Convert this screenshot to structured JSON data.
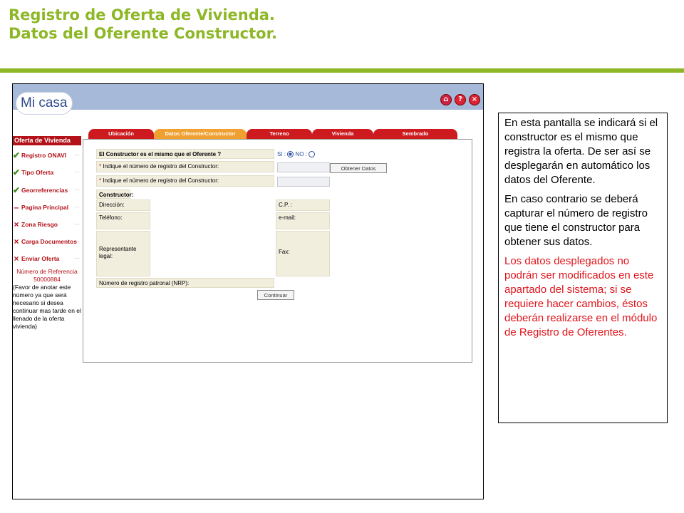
{
  "slide": {
    "title_line1": "Registro de Oferta de Vivienda.",
    "title_line2": "Datos del Oferente Constructor."
  },
  "app": {
    "logo": "Mi casa",
    "window_icons": [
      "home-icon",
      "help-icon",
      "close-icon"
    ]
  },
  "sidebar": {
    "title": "Oferta de Vivienda",
    "items": [
      {
        "label": "Registro ONAVI",
        "status": "✔",
        "icon": "check-icon"
      },
      {
        "label": "Tipo Oferta",
        "status": "✔",
        "icon": "check-icon"
      },
      {
        "label": "Georreferencias",
        "status": "✔",
        "icon": "check-icon"
      },
      {
        "label": "Pagina Principal",
        "status": "–",
        "icon": "dash-icon"
      },
      {
        "label": "Zona Riesgo",
        "status": "×",
        "icon": "x-icon"
      },
      {
        "label": "Carga Documentos",
        "status": "×",
        "icon": "x-icon"
      },
      {
        "label": "Enviar Oferta",
        "status": "×",
        "icon": "x-icon"
      }
    ],
    "ref_title": "Número de Referencia",
    "ref_number": "50000884",
    "ref_note": "(Favor de anotar este número ya que será necesario si desea continuar mas tarde en el llenado de la oferta vivienda)"
  },
  "tabs": [
    {
      "label": "Ubicación"
    },
    {
      "label": "Datos Oferente/Constructor"
    },
    {
      "label": "Terreno"
    },
    {
      "label": "Vivienda"
    },
    {
      "label": "Sembrado"
    }
  ],
  "form": {
    "question": "El Constructor es el mismo que el Oferente ?",
    "si_label": "SI :",
    "no_label": "NO :",
    "selected": "SI",
    "field1_label": "Indique el número de registro del Constructor:",
    "field2_label": "Indique el número de registro del Constructor:",
    "obtain_button": "Obtener Datos",
    "section_title": "Constructor:",
    "direccion": "Dirección:",
    "telefono": "Teléfono:",
    "representante": "Representante legal:",
    "cp": "C.P. :",
    "email": "e-mail:",
    "fax": "Fax:",
    "nrp": "Número de registro patronal (NRP):",
    "continue_button": "Continuar"
  },
  "note": {
    "p1": "En esta pantalla se indicará si el constructor es el mismo que registra la oferta. De ser así se desplegarán en automático los datos del Oferente.",
    "p2": "En caso contrario se deberá capturar el número de registro que tiene el constructor para obtener sus datos.",
    "p3": "Los datos desplegados no podrán ser modificados en este apartado del sistema; si se requiere hacer cambios, éstos deberán realizarse en el módulo de Registro de Oferentes."
  },
  "colors": {
    "title_green": "#8db726",
    "accent_red": "#b4121a",
    "active_tab": "#f0a030",
    "note_red": "#e0141b"
  }
}
